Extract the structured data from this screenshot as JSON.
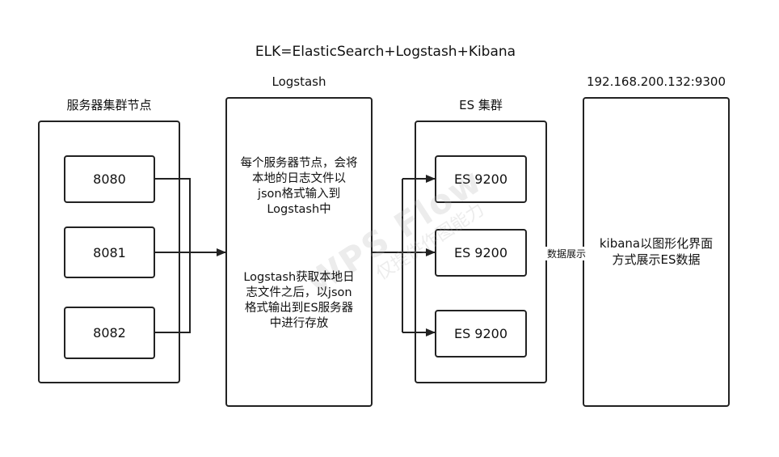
{
  "title": "ELK=ElasticSearch+Logstash+Kibana",
  "servers": {
    "title": "服务器集群节点",
    "ports": [
      "8080",
      "8081",
      "8082"
    ]
  },
  "logstash": {
    "title": "Logstash",
    "description_1": [
      "每个服务器节点，会将",
      "本地的日志文件以",
      "json格式输入到",
      "Logstash中"
    ],
    "description_2": [
      "Logstash获取本地日",
      "志文件之后，以json",
      "格式输出到ES服务器",
      "中进行存放"
    ]
  },
  "es": {
    "title": "ES 集群",
    "nodes": [
      "ES 9200",
      "ES 9200",
      "ES 9200"
    ]
  },
  "kibana": {
    "title": "192.168.200.132:9300",
    "description": [
      "kibana以图形化界面",
      "方式展示ES数据"
    ]
  },
  "edge_label": "数据展示",
  "watermark": {
    "main": "WPS Flow",
    "sub": "仅提供作图能力"
  },
  "colors": {
    "stroke": "#222222",
    "background": "#ffffff",
    "watermark": "#b4b4b4"
  }
}
